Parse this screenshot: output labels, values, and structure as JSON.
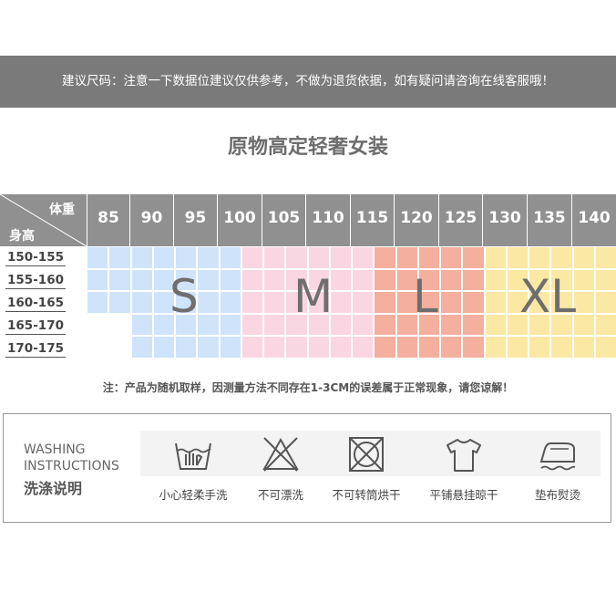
{
  "banner": {
    "text": "建议尺码：注意一下数据位建议仅供参考，不做为退货依据，如有疑问请咨询在线客服哦！"
  },
  "title": "原物高定轻奢女装",
  "table": {
    "weight_label": "体重",
    "height_label": "身高",
    "weights": [
      "85",
      "90",
      "95",
      "100",
      "105",
      "110",
      "115",
      "120",
      "125",
      "130",
      "135",
      "140"
    ],
    "heights": [
      "150-155",
      "155-160",
      "160-165",
      "165-170",
      "170-175"
    ],
    "sizes": [
      {
        "label": "S",
        "color": "#cfe4fb"
      },
      {
        "label": "M",
        "color": "#fad6e2"
      },
      {
        "label": "L",
        "color": "#f4af9e"
      },
      {
        "label": "XL",
        "color": "#fbe8a3"
      }
    ]
  },
  "note": "注：产品为随机取样，因测量方法不同存在1-3CM的误差属于正常现象，请您谅解！",
  "washing": {
    "title_en_1": "WASHING",
    "title_en_2": "INSTRUCTIONS",
    "title_cn": "洗涤说明",
    "items": [
      {
        "label": "小心轻柔手洗",
        "icon": "hand-wash-icon"
      },
      {
        "label": "不可漂洗",
        "icon": "no-bleach-icon"
      },
      {
        "label": "不可转筒烘干",
        "icon": "no-tumble-dry-icon"
      },
      {
        "label": "平铺悬挂晾干",
        "icon": "hang-dry-icon"
      },
      {
        "label": "垫布熨烫",
        "icon": "iron-with-cloth-icon"
      }
    ]
  }
}
